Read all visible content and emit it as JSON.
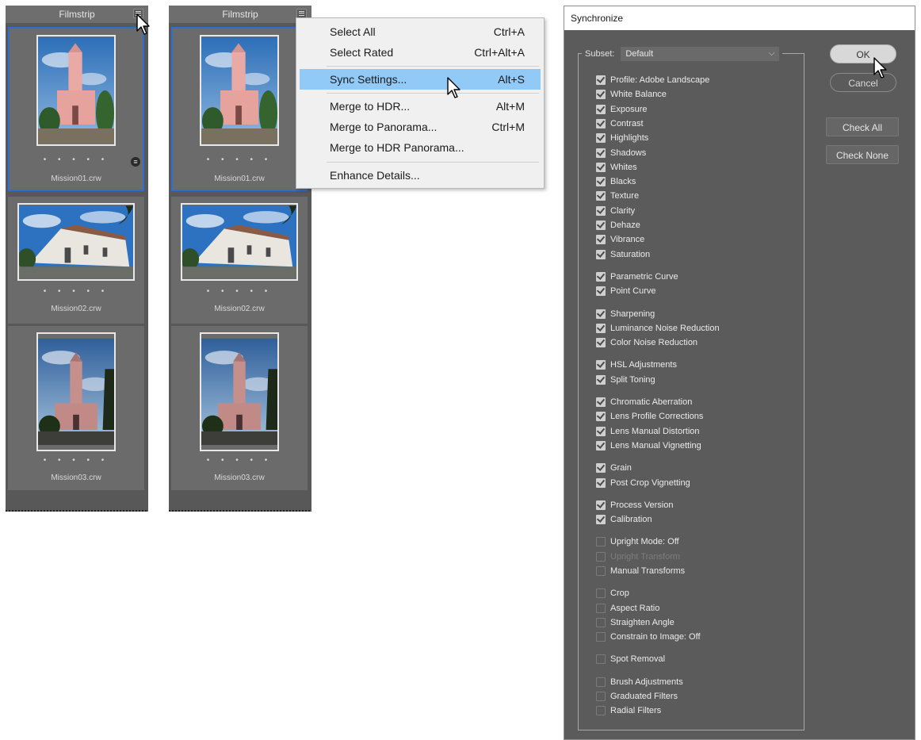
{
  "filmstrip_left": {
    "title": "Filmstrip",
    "thumbnails": [
      {
        "filename": "Mission01.crw",
        "rating_dots": "• • • • •",
        "selected": true
      },
      {
        "filename": "Mission02.crw",
        "rating_dots": "• • • • •",
        "selected": false
      },
      {
        "filename": "Mission03.crw",
        "rating_dots": "• • • • •",
        "selected": false
      }
    ]
  },
  "filmstrip_right": {
    "title": "Filmstrip",
    "thumbnails": [
      {
        "filename": "Mission01.crw",
        "rating_dots": "• • • • •",
        "selected": true
      },
      {
        "filename": "Mission02.crw",
        "rating_dots": "• • • • •",
        "selected": false
      },
      {
        "filename": "Mission03.crw",
        "rating_dots": "• • • • •",
        "selected": false
      }
    ]
  },
  "context_menu": {
    "items": [
      {
        "label": "Select All",
        "shortcut": "Ctrl+A"
      },
      {
        "label": "Select Rated",
        "shortcut": "Ctrl+Alt+A"
      },
      {
        "label": "Sync Settings...",
        "shortcut": "Alt+S",
        "highlighted": true
      },
      {
        "label": "Merge to HDR...",
        "shortcut": "Alt+M"
      },
      {
        "label": "Merge to Panorama...",
        "shortcut": "Ctrl+M"
      },
      {
        "label": "Merge to HDR Panorama...",
        "shortcut": ""
      },
      {
        "label": "Enhance Details...",
        "shortcut": ""
      }
    ]
  },
  "sync_dialog": {
    "title": "Synchronize",
    "subset_label": "Subset:",
    "subset_value": "Default",
    "buttons": {
      "ok": "OK",
      "cancel": "Cancel",
      "check_all": "Check All",
      "check_none": "Check None"
    },
    "options": [
      {
        "label": "Profile: Adobe Landscape",
        "checked": true
      },
      {
        "label": "White Balance",
        "checked": true
      },
      {
        "label": "Exposure",
        "checked": true
      },
      {
        "label": "Contrast",
        "checked": true
      },
      {
        "label": "Highlights",
        "checked": true
      },
      {
        "label": "Shadows",
        "checked": true
      },
      {
        "label": "Whites",
        "checked": true
      },
      {
        "label": "Blacks",
        "checked": true
      },
      {
        "label": "Texture",
        "checked": true
      },
      {
        "label": "Clarity",
        "checked": true
      },
      {
        "label": "Dehaze",
        "checked": true
      },
      {
        "label": "Vibrance",
        "checked": true
      },
      {
        "label": "Saturation",
        "checked": true
      },
      {
        "label": "Parametric Curve",
        "checked": true
      },
      {
        "label": "Point Curve",
        "checked": true
      },
      {
        "label": "Sharpening",
        "checked": true
      },
      {
        "label": "Luminance Noise Reduction",
        "checked": true
      },
      {
        "label": "Color Noise Reduction",
        "checked": true
      },
      {
        "label": "HSL Adjustments",
        "checked": true
      },
      {
        "label": "Split Toning",
        "checked": true
      },
      {
        "label": "Chromatic Aberration",
        "checked": true
      },
      {
        "label": "Lens Profile Corrections",
        "checked": true
      },
      {
        "label": "Lens Manual Distortion",
        "checked": true
      },
      {
        "label": "Lens Manual Vignetting",
        "checked": true
      },
      {
        "label": "Grain",
        "checked": true
      },
      {
        "label": "Post Crop Vignetting",
        "checked": true
      },
      {
        "label": "Process Version",
        "checked": true
      },
      {
        "label": "Calibration",
        "checked": true
      },
      {
        "label": "Upright Mode: Off",
        "checked": false
      },
      {
        "label": "Upright Transform",
        "checked": false,
        "disabled": true
      },
      {
        "label": "Manual Transforms",
        "checked": false
      },
      {
        "label": "Crop",
        "checked": false
      },
      {
        "label": "Aspect Ratio",
        "checked": false
      },
      {
        "label": "Straighten Angle",
        "checked": false
      },
      {
        "label": "Constrain to Image: Off",
        "checked": false
      },
      {
        "label": "Spot Removal",
        "checked": false
      },
      {
        "label": "Brush Adjustments",
        "checked": false
      },
      {
        "label": "Graduated Filters",
        "checked": false
      },
      {
        "label": "Radial Filters",
        "checked": false
      }
    ]
  },
  "colors": {
    "panel_bg": "#585858",
    "selection_border": "#2d6fcc",
    "menu_highlight": "#91c9f7"
  }
}
